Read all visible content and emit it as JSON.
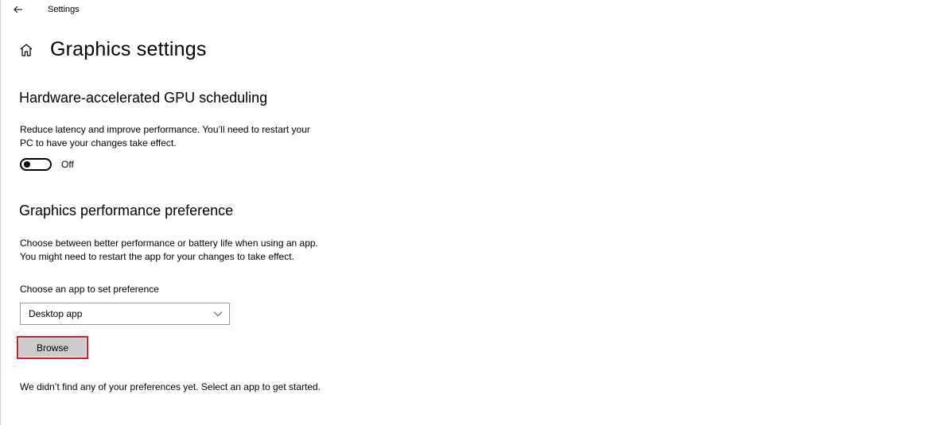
{
  "titlebar": {
    "app_title": "Settings",
    "back_icon": "back-arrow-icon"
  },
  "page": {
    "home_icon": "home-icon",
    "title": "Graphics settings"
  },
  "gpu_scheduling": {
    "heading": "Hardware-accelerated GPU scheduling",
    "description_line1": "Reduce latency and improve performance. You’ll need to restart your",
    "description_line2": "PC to have your changes take effect.",
    "toggle_on": false,
    "toggle_state_label": "Off"
  },
  "performance_preference": {
    "heading": "Graphics performance preference",
    "description_line1": "Choose between better performance or battery life when using an app.",
    "description_line2": "You might need to restart the app for your changes to take effect.",
    "choose_label": "Choose an app to set preference",
    "dropdown_selected": "Desktop app",
    "browse_label": "Browse",
    "empty_message": "We didn’t find any of your preferences yet. Select an app to get started."
  },
  "colors": {
    "highlight": "#e81123",
    "button_bg": "#cccccc",
    "dropdown_border": "#999999"
  }
}
